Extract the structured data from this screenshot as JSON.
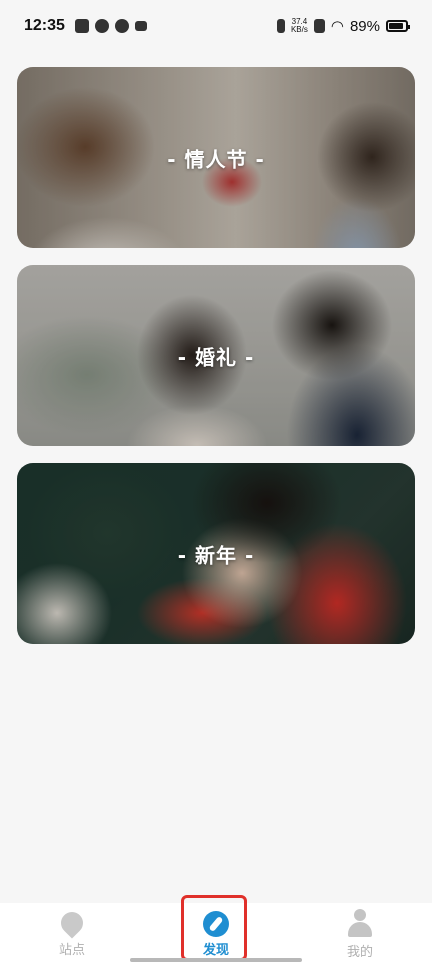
{
  "status_bar": {
    "time": "12:35",
    "net_speed_value": "37.4",
    "net_speed_unit": "KB/s",
    "battery": "89%"
  },
  "cards": [
    {
      "title": "- 情人节 -"
    },
    {
      "title": "- 婚礼 -"
    },
    {
      "title": "- 新年 -"
    }
  ],
  "bottom_nav": [
    {
      "label": "站点",
      "icon": "location-pin-icon",
      "active": false
    },
    {
      "label": "发现",
      "icon": "compass-icon",
      "active": true
    },
    {
      "label": "我的",
      "icon": "person-icon",
      "active": false
    }
  ],
  "colors": {
    "accent": "#1f8ed1",
    "highlight": "#e0302a",
    "background": "#f6f6f6"
  }
}
